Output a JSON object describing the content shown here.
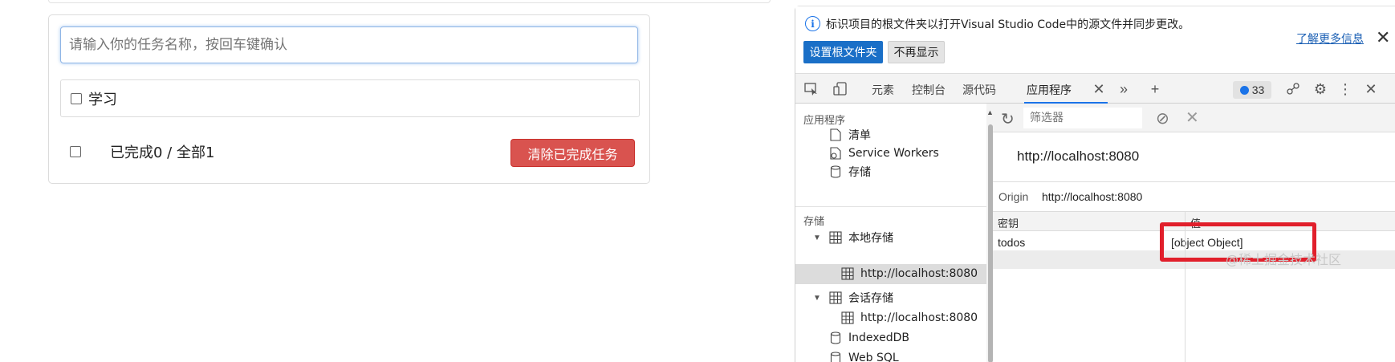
{
  "app": {
    "input_placeholder": "请输入你的任务名称，按回车键确认",
    "todos": [
      {
        "label": "学习",
        "done": false
      }
    ],
    "footer_count": "已完成0 / 全部1",
    "clear_button": "清除已完成任务"
  },
  "devtools": {
    "infobar": {
      "info_glyph": "i",
      "message": "标识项目的根文件夹以打开Visual Studio Code中的源文件并同步更改。",
      "primary_button": "设置根文件夹",
      "secondary_button": "不再显示",
      "learn_more": "了解更多信息"
    },
    "tabs": [
      "元素",
      "控制台",
      "源代码",
      "应用程序"
    ],
    "issues_count": "33",
    "sidebar": {
      "section_app": "应用程序",
      "app_items": [
        "清单",
        "Service Workers",
        "存储"
      ],
      "section_storage": "存储",
      "local_storage": "本地存储",
      "local_storage_origin": "http://localhost:8080",
      "session_storage": "会话存储",
      "session_storage_origin": "http://localhost:8080",
      "indexeddb": "IndexedDB",
      "websql": "Web SQL"
    },
    "main": {
      "filter_placeholder": "筛选器",
      "origin_title": "http://localhost:8080",
      "origin_label": "Origin",
      "origin_value": "http://localhost:8080",
      "columns": [
        "密钥",
        "值"
      ],
      "rows": [
        {
          "key": "todos",
          "value": "[object Object]"
        }
      ]
    }
  },
  "watermark": "@稀土掘金技术社区",
  "colors": {
    "danger": "#d9534f",
    "devtools_primary": "#1a6fc7",
    "highlight": "#e11f2b",
    "link": "#1a5fb4"
  }
}
